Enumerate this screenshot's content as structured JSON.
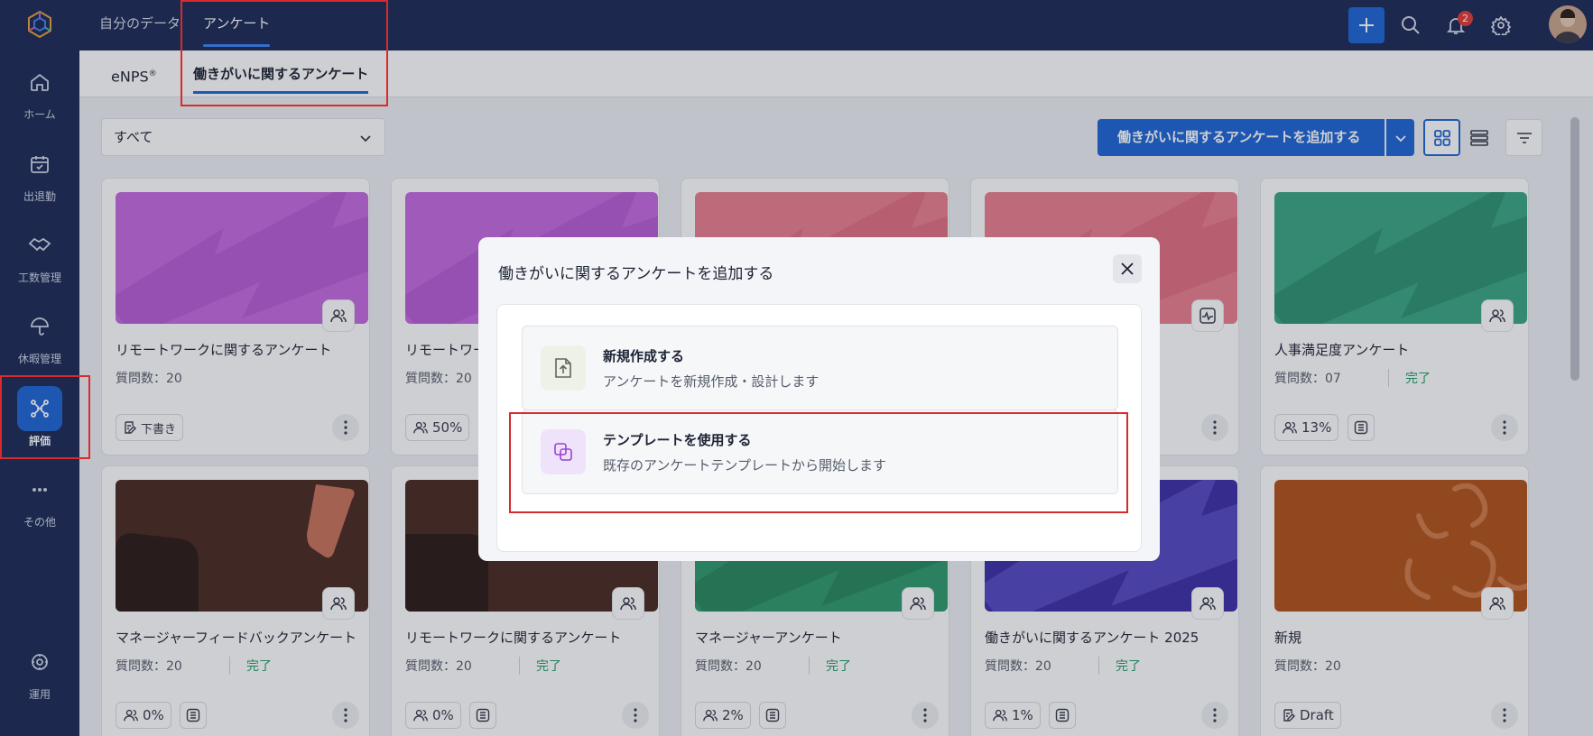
{
  "top_nav": {
    "tabs": [
      {
        "label": "自分のデータ"
      },
      {
        "label": "アンケート"
      }
    ],
    "notifications_count": "2"
  },
  "sidebar": {
    "items": [
      {
        "label": "ホーム",
        "icon": "home-icon"
      },
      {
        "label": "出退勤",
        "icon": "calendar-check-icon"
      },
      {
        "label": "工数管理",
        "icon": "handshake-icon"
      },
      {
        "label": "休暇管理",
        "icon": "umbrella-icon"
      },
      {
        "label": "評価",
        "icon": "evaluation-icon"
      },
      {
        "label": "その他",
        "icon": "more-icon"
      },
      {
        "label": "運用",
        "icon": "operations-icon"
      }
    ]
  },
  "sub_tabs": [
    {
      "label": "eNPS",
      "sup": "®"
    },
    {
      "label": "働きがいに関するアンケート"
    }
  ],
  "toolbar": {
    "filter_value": "すべて",
    "add_button_label": "働きがいに関するアンケートを追加する"
  },
  "cards": [
    {
      "title": "リモートワークに関するアンケート",
      "questions": "質問数：20",
      "status": "",
      "chip": "下書き",
      "chip_icon": "draft-icon",
      "progress": "",
      "color": "#c36ae0"
    },
    {
      "title": "リモートワークに関するアンケート",
      "questions": "質問数：20",
      "status": "",
      "chip": "",
      "chip_icon": "",
      "progress": "50%",
      "color": "#c36ae0"
    },
    {
      "title": "",
      "questions": "",
      "status": "",
      "chip": "",
      "chip_icon": "",
      "progress": "",
      "color": "#ea7f90"
    },
    {
      "title": "",
      "questions": "",
      "status": "",
      "chip": "",
      "chip_icon": "",
      "progress": "",
      "color": "#ea7f90"
    },
    {
      "title": "人事満足度アンケート",
      "questions": "質問数：07",
      "status": "完了",
      "chip": "",
      "chip_icon": "",
      "progress": "13%",
      "color": "#3aa685"
    },
    {
      "title": "マネージャーフィードバックアンケート",
      "questions": "質問数：20",
      "status": "完了",
      "chip": "",
      "chip_icon": "",
      "progress": "0%",
      "color": "#4a2a22"
    },
    {
      "title": "リモートワークに関するアンケート",
      "questions": "質問数：20",
      "status": "完了",
      "chip": "",
      "chip_icon": "",
      "progress": "0%",
      "color": "#4a2a22"
    },
    {
      "title": "マネージャーアンケート",
      "questions": "質問数：20",
      "status": "完了",
      "chip": "",
      "chip_icon": "",
      "progress": "2%",
      "color": "#2f9a6c"
    },
    {
      "title": "働きがいに関するアンケート 2025",
      "questions": "質問数：20",
      "status": "完了",
      "chip": "",
      "chip_icon": "",
      "progress": "1%",
      "color": "#3b2fa8"
    },
    {
      "title": "新規",
      "questions": "質問数：20",
      "status": "",
      "chip": "Draft",
      "chip_icon": "draft-icon",
      "progress": "",
      "color": "#b2521a"
    }
  ],
  "modal": {
    "title": "働きがいに関するアンケートを追加する",
    "options": [
      {
        "title": "新規作成する",
        "desc": "アンケートを新規作成・設計します",
        "icon": "file-upload-icon"
      },
      {
        "title": "テンプレートを使用する",
        "desc": "既存のアンケートテンプレートから開始します",
        "icon": "copy-icon"
      }
    ]
  },
  "colors": {
    "nav_bg": "#1b2a55",
    "accent": "#1e66d6",
    "highlight": "#d92b2b",
    "done": "#1f9d63"
  }
}
